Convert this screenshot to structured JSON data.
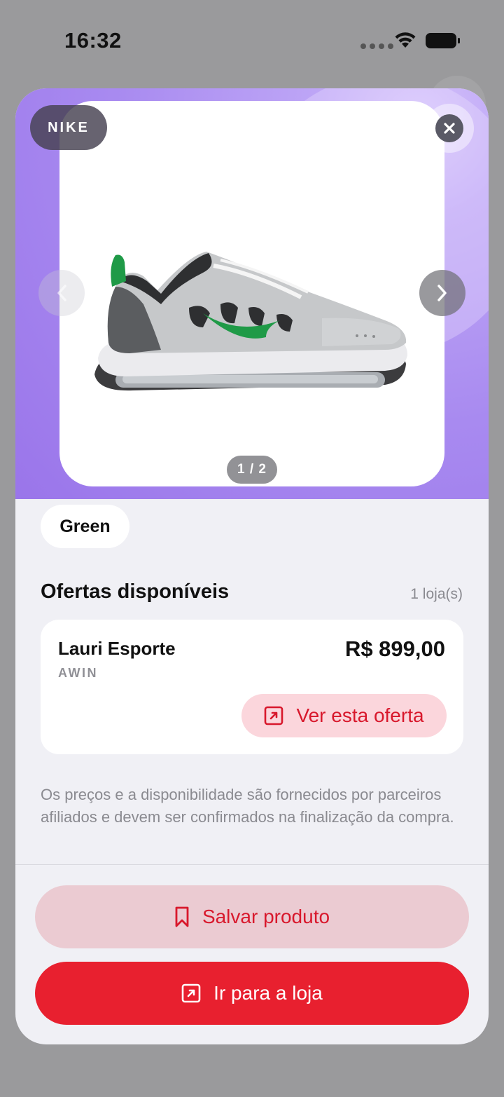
{
  "status_bar": {
    "time": "16:32"
  },
  "product": {
    "brand": "NIKE",
    "image_page": "1 / 2",
    "color": "Green"
  },
  "offers": {
    "title": "Ofertas disponíveis",
    "count": "1 loja(s)",
    "items": [
      {
        "store": "Lauri Esporte",
        "network": "AWIN",
        "price": "R$ 899,00",
        "action_label": "Ver esta oferta"
      }
    ],
    "disclaimer": "Os preços e a disponibilidade são fornecidos por parceiros afiliados e devem ser confirmados na finalização da compra."
  },
  "actions": {
    "save_label": "Salvar produto",
    "go_to_store_label": "Ir para a loja"
  },
  "colors": {
    "accent": "#e8202f",
    "hero_purple": "#a88af0",
    "shoe_swoosh": "#1f9a47"
  },
  "icons": [
    "wifi-icon",
    "battery-icon",
    "close-icon",
    "chevron-left-icon",
    "chevron-right-icon",
    "external-link-icon",
    "bookmark-icon"
  ]
}
